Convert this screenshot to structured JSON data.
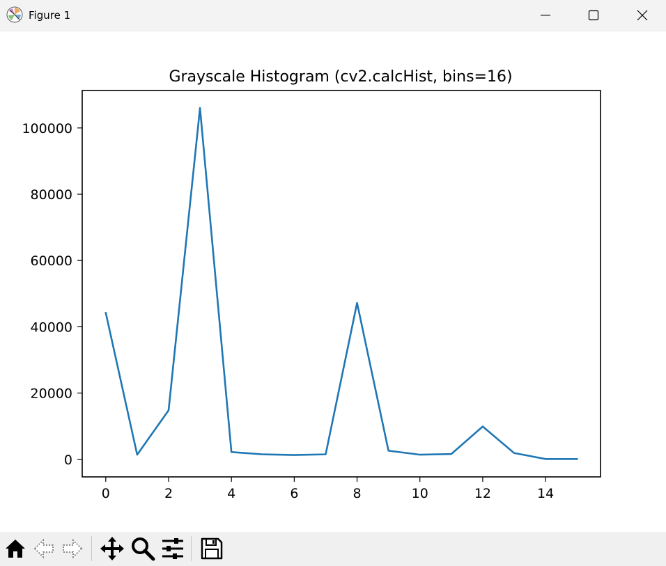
{
  "window": {
    "title": "Figure 1"
  },
  "toolbar": {
    "buttons": [
      {
        "name": "home-icon"
      },
      {
        "name": "back-icon"
      },
      {
        "name": "forward-icon"
      },
      {
        "name": "pan-icon"
      },
      {
        "name": "zoom-icon"
      },
      {
        "name": "configure-subplots-icon"
      },
      {
        "name": "save-icon"
      }
    ]
  },
  "colors": {
    "line": "#1f77b4",
    "titlebar": "#f3f3f3",
    "toolbar": "#f0f0f0"
  },
  "chart_data": {
    "type": "line",
    "title": "Grayscale Histogram (cv2.calcHist, bins=16)",
    "xlabel": "",
    "ylabel": "",
    "x": [
      0,
      1,
      2,
      3,
      4,
      5,
      6,
      7,
      8,
      9,
      10,
      11,
      12,
      13,
      14,
      15
    ],
    "series": [
      {
        "values": [
          44200,
          1400,
          14800,
          106000,
          2200,
          1500,
          1300,
          1500,
          47200,
          2600,
          1400,
          1600,
          9900,
          1900,
          100,
          100
        ]
      }
    ],
    "xlim": [
      -0.75,
      15.75
    ],
    "ylim": [
      -5300,
      111300
    ],
    "xticks": [
      0,
      2,
      4,
      6,
      8,
      10,
      12,
      14
    ],
    "yticks": [
      0,
      20000,
      40000,
      60000,
      80000,
      100000
    ],
    "grid": false,
    "legend": "none"
  }
}
